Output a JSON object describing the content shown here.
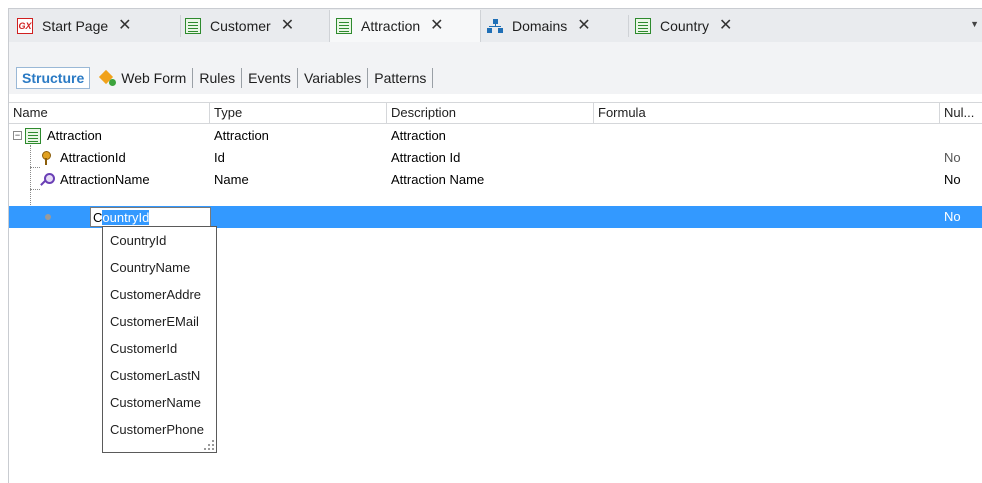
{
  "tabs": [
    {
      "label": "Start Page",
      "icon": "gx-icon",
      "active": false
    },
    {
      "label": "Customer",
      "icon": "transaction-icon",
      "active": false
    },
    {
      "label": "Attraction",
      "icon": "transaction-icon",
      "active": true
    },
    {
      "label": "Domains",
      "icon": "domains-icon",
      "active": false
    },
    {
      "label": "Country",
      "icon": "transaction-icon",
      "active": false
    }
  ],
  "tab_close_glyph": "✕",
  "gx_label": "GX",
  "overflow_glyph": "▼",
  "sub_tabs": [
    {
      "label": "Structure",
      "active": true
    },
    {
      "label": "Web Form",
      "active": false
    },
    {
      "label": "Rules",
      "active": false
    },
    {
      "label": "Events",
      "active": false
    },
    {
      "label": "Variables",
      "active": false
    },
    {
      "label": "Patterns",
      "active": false
    }
  ],
  "columns": [
    "Name",
    "Type",
    "Description",
    "Formula",
    "Nul..."
  ],
  "rows": [
    {
      "name": "Attraction",
      "type": "Attraction",
      "description": "Attraction",
      "formula": "",
      "nullable": ""
    },
    {
      "name": "AttractionId",
      "type": "Id",
      "description": "Attraction Id",
      "formula": "",
      "nullable": "No"
    },
    {
      "name": "AttractionName",
      "type": "Name",
      "description": "Attraction Name",
      "formula": "",
      "nullable": "No"
    },
    {
      "name_first": "C",
      "name_rest": "ountryId",
      "type": "",
      "description": "",
      "formula": "",
      "nullable": "No"
    }
  ],
  "autocomplete": [
    "CountryId",
    "CountryName",
    "CustomerAddre",
    "CustomerEMail",
    "CustomerId",
    "CustomerLastN",
    "CustomerName",
    "CustomerPhone"
  ],
  "colors": {
    "selection": "#3399ff",
    "active_subtab": "#2a7ac4"
  }
}
